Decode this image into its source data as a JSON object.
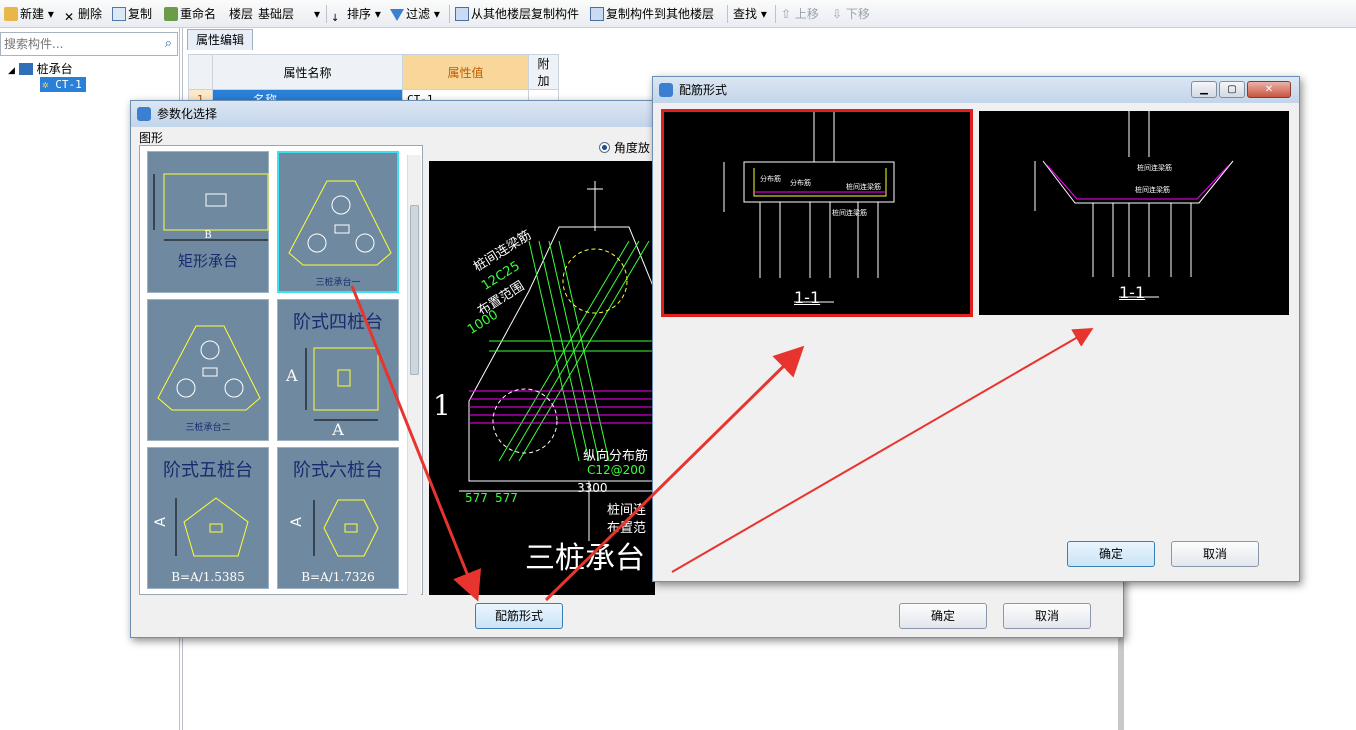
{
  "toolbar": {
    "new": "新建",
    "delete": "删除",
    "copy": "复制",
    "rename": "重命名",
    "floor_label": "楼层",
    "floor_value": "基础层",
    "sort": "排序",
    "filter": "过滤",
    "copy_from_other": "从其他楼层复制构件",
    "copy_to_other": "复制构件到其他楼层",
    "find": "查找",
    "move_up": "上移",
    "move_down": "下移"
  },
  "left_panel": {
    "search_placeholder": "搜索构件...",
    "tree_root": "桩承台",
    "tree_child": "CT-1"
  },
  "property_editor": {
    "tab": "属性编辑",
    "headers": [
      "属性名称",
      "属性值",
      "附加"
    ],
    "rows": [
      {
        "index": "1",
        "name": "名称",
        "value": "CT-1"
      }
    ]
  },
  "param_dialog": {
    "title": "参数化选择",
    "group_label": "图形",
    "radio_label": "角度放",
    "thumbnails": [
      {
        "caption": "矩形承台",
        "dim": "B"
      },
      {
        "caption": "三桩承台一",
        "dim": ""
      },
      {
        "caption": "三桩承台二",
        "dim": ""
      },
      {
        "caption": "阶式四桩台",
        "dim": "A"
      },
      {
        "caption": "阶式五桩台",
        "dim": "B=A/1.5385"
      },
      {
        "caption": "阶式六桩台",
        "dim": "B=A/1.7326"
      }
    ],
    "preview": {
      "label_1": "1",
      "note_1": "桩间连梁筋",
      "note_1_val": "12C25",
      "note_2": "布置范围",
      "note_2_val": "1000",
      "note_3": "纵向分布筋",
      "note_3_val": "C12@200",
      "dim_a": "577",
      "dim_b": "577",
      "dim_total": "3300",
      "note_4": "桩间连",
      "note_5": "布置范",
      "caption": "三桩承台"
    },
    "btn_rebar": "配筋形式",
    "btn_ok": "确定",
    "btn_cancel": "取消"
  },
  "rebar_dialog": {
    "title": "配筋形式",
    "option_1": {
      "section": "1-1",
      "label_a": "分布筋",
      "label_b": "分布筋",
      "label_c": "桩间连梁筋",
      "label_d": "桩间连梁筋"
    },
    "option_2": {
      "section": "1-1",
      "label_a": "桩间连梁筋",
      "label_b": "桩间连梁筋"
    },
    "btn_ok": "确定",
    "btn_cancel": "取消"
  },
  "colors": {
    "highlight": "#e02020",
    "cad_green": "#39ff39",
    "cad_magenta": "#ff00ff",
    "arrow": "#e8342f"
  }
}
